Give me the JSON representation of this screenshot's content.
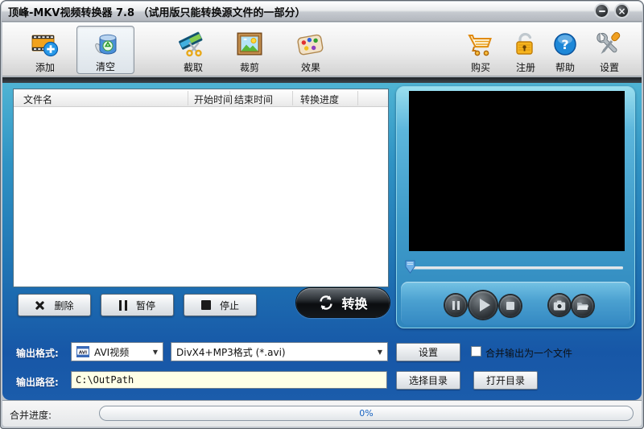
{
  "window": {
    "title": "顶峰-MKV视频转换器 7.8 （试用版只能转换源文件的一部分）",
    "controls": [
      {
        "name": "minimize",
        "icon": "minimize-icon"
      },
      {
        "name": "close",
        "icon": "close-icon"
      }
    ]
  },
  "toolbar": {
    "left": [
      {
        "label": "添加",
        "icon": "film-add-icon",
        "selected": false
      },
      {
        "label": "清空",
        "icon": "clear-bin-icon",
        "selected": true
      },
      {
        "label": "截取",
        "icon": "film-scissors-icon",
        "selected": false
      },
      {
        "label": "裁剪",
        "icon": "picture-crop-icon",
        "selected": false
      },
      {
        "label": "效果",
        "icon": "palette-icon",
        "selected": false
      }
    ],
    "right": [
      {
        "label": "购买",
        "icon": "cart-icon"
      },
      {
        "label": "注册",
        "icon": "padlock-icon"
      },
      {
        "label": "帮助",
        "icon": "help-icon"
      },
      {
        "label": "设置",
        "icon": "tools-icon"
      }
    ]
  },
  "file_list": {
    "columns": [
      "文件名",
      "开始时间",
      "结束时间",
      "转换进度"
    ],
    "rows": []
  },
  "list_actions": {
    "delete": "删除",
    "pause": "暂停",
    "stop": "停止",
    "convert": "转换"
  },
  "preview": {
    "seek_percent": 0,
    "controls": [
      {
        "name": "pause",
        "icon": "pause-icon"
      },
      {
        "name": "play",
        "icon": "play-icon"
      },
      {
        "name": "stop",
        "icon": "stop-icon"
      },
      {
        "name": "snapshot",
        "icon": "camera-icon"
      },
      {
        "name": "open-folder",
        "icon": "folder-icon"
      }
    ]
  },
  "output_format": {
    "label": "输出格式:",
    "format_value": "AVI视频",
    "format_icon": "avi-file-icon",
    "profile_value": "DivX4+MP3格式 (*.avi)",
    "settings_button": "设置",
    "merge_label": "合并输出为一个文件",
    "merge_checked": false
  },
  "output_path": {
    "label": "输出路径:",
    "value": "C:\\OutPath",
    "choose_button": "选择目录",
    "open_button": "打开目录"
  },
  "status_bar": {
    "label": "合并进度:",
    "progress_text": "0%",
    "progress_percent": 0
  },
  "colors": {
    "content_gradient_top": "#4fb4d4",
    "content_gradient_bottom": "#1b5cab",
    "titlebar_silver": "#c6cad0",
    "path_field_bg": "#ffffe6",
    "progress_text_blue": "#1560c0",
    "register_orange": "#f6b41e",
    "help_blue": "#1e88d8",
    "film_orange": "#f2a21c"
  }
}
